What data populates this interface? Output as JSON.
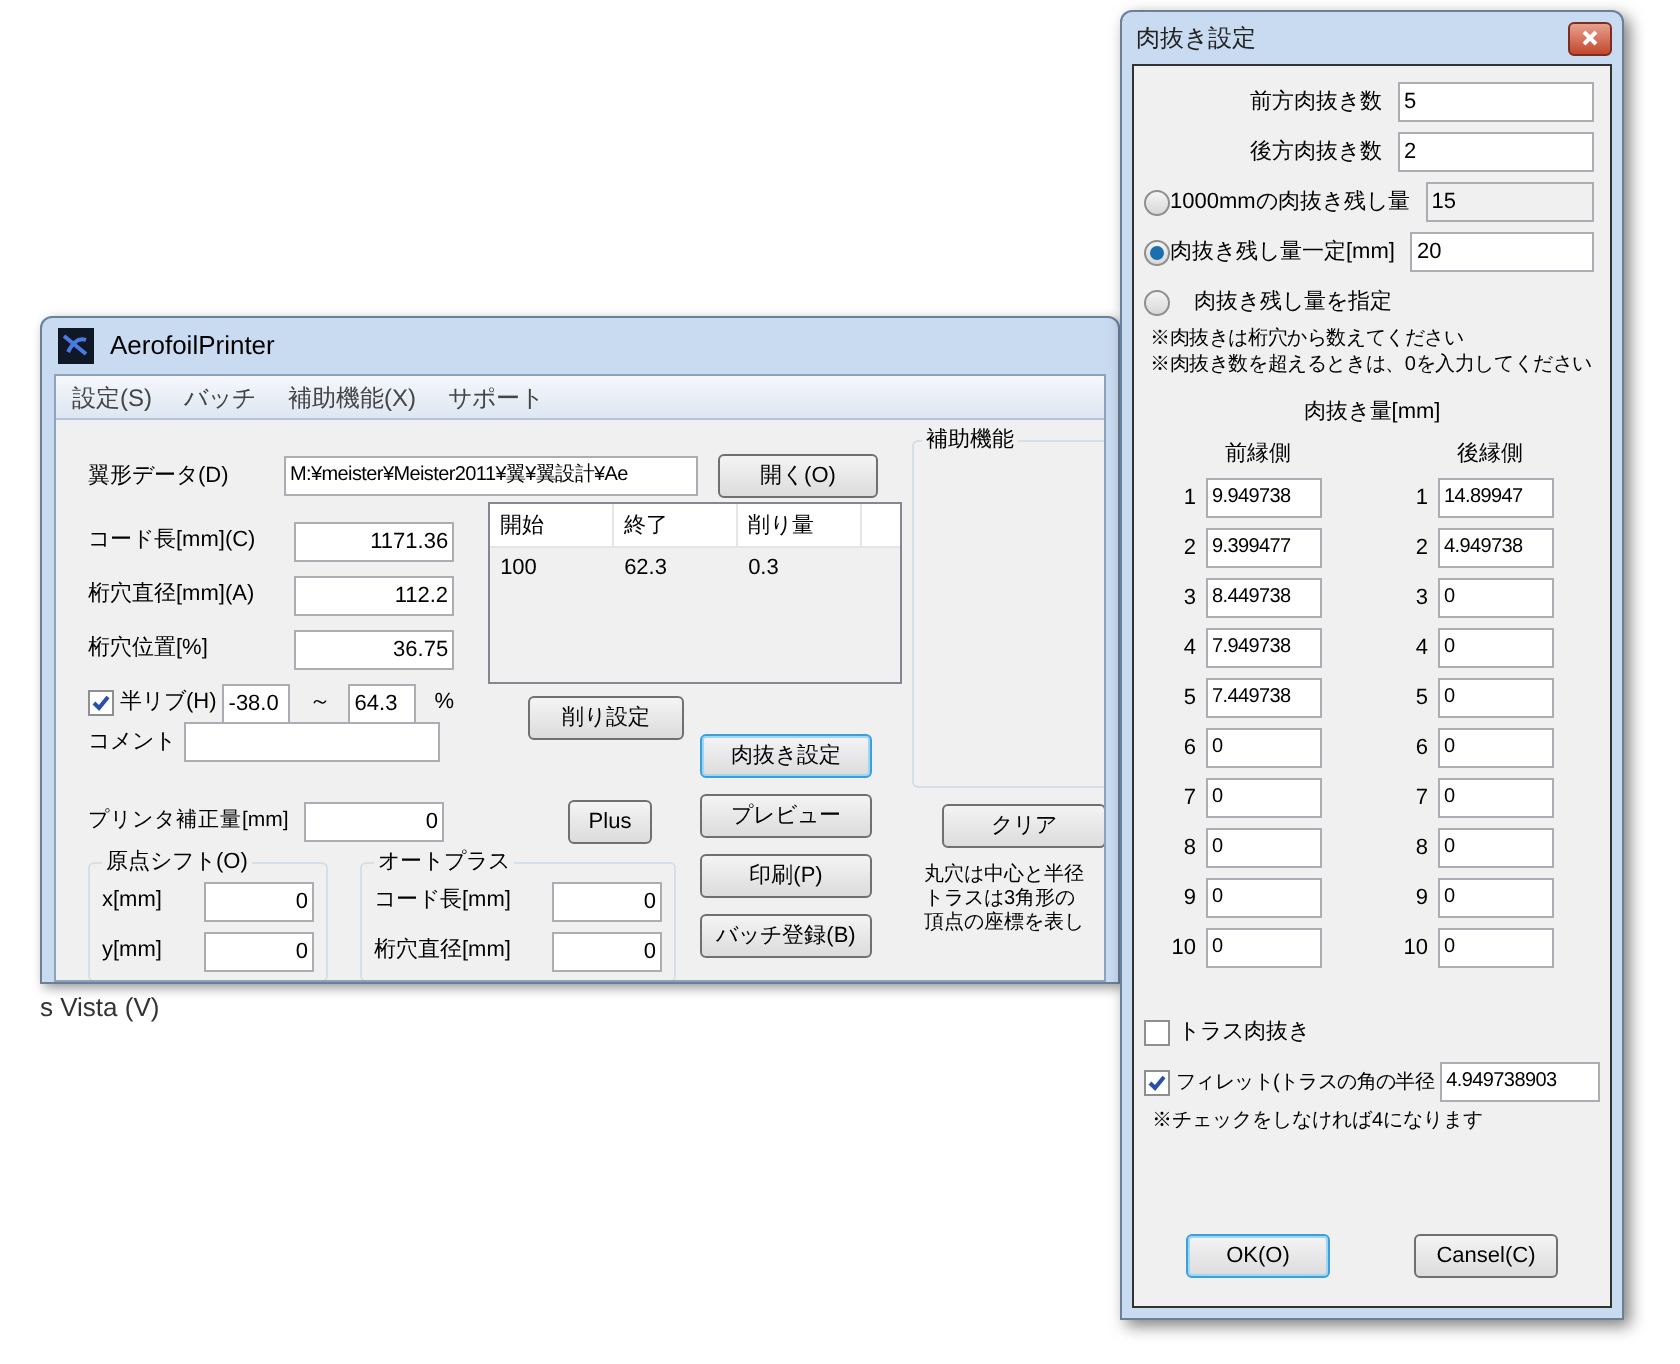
{
  "background_text": "s Vista (V)",
  "main_window": {
    "title": "AerofoilPrinter",
    "menu": [
      "設定(S)",
      "バッチ",
      "補助機能(X)",
      "サポート"
    ],
    "airfoil_data": {
      "label": "翼形データ(D)",
      "value": "M:¥meister¥Meister2011¥翼¥翼設計¥Ae"
    },
    "open_button": "開く(O)",
    "fields": [
      {
        "label": "コード長[mm](C)",
        "value": "1171.36"
      },
      {
        "label": "桁穴直径[mm](A)",
        "value": "112.2"
      },
      {
        "label": "桁穴位置[%]",
        "value": "36.75"
      }
    ],
    "half_rib": {
      "label": "半リブ(H)",
      "checked": true,
      "from": "-38.0",
      "separator": "～",
      "to": "64.3",
      "unit": "%"
    },
    "comment": {
      "label": "コメント"
    },
    "table": {
      "columns": [
        "開始",
        "終了",
        "削り量"
      ],
      "rows": [
        [
          "100",
          "62.3",
          "0.3"
        ]
      ]
    },
    "cut_settings_button": "削り設定",
    "printer_correction": {
      "label": "プリンタ補正量[mm]",
      "value": "0"
    },
    "plus_button": "Plus",
    "origin_shift": {
      "title": "原点シフト(O)",
      "fields": [
        {
          "label": "x[mm]",
          "value": "0"
        },
        {
          "label": "y[mm]",
          "value": "0"
        }
      ]
    },
    "auto_plus": {
      "title": "オートプラス",
      "fields": [
        {
          "label": "コード長[mm]",
          "value": "0"
        },
        {
          "label": "桁穴直径[mm]",
          "value": "0"
        }
      ]
    },
    "action_buttons": [
      {
        "label": "肉抜き設定",
        "focused": true
      },
      {
        "label": "プレビュー",
        "focused": false
      },
      {
        "label": "印刷(P)",
        "focused": false
      },
      {
        "label": "バッチ登録(B)",
        "focused": false
      }
    ],
    "aux_group": {
      "title": "補助機能"
    },
    "clear_button": "クリア",
    "note_lines": [
      "丸穴は中心と半径",
      "トラスは3角形の",
      "頂点の座標を表し"
    ]
  },
  "dialog": {
    "title": "肉抜き設定",
    "front_count": {
      "label": "前方肉抜き数",
      "value": "5"
    },
    "rear_count": {
      "label": "後方肉抜き数",
      "value": "2"
    },
    "options": [
      {
        "label": "1000mmの肉抜き残し量",
        "selected": false,
        "value": "15",
        "disabled": true
      },
      {
        "label": "肉抜き残し量一定[mm]",
        "selected": true,
        "value": "20",
        "disabled": false
      },
      {
        "label": "肉抜き残し量を指定",
        "selected": false
      }
    ],
    "notes": [
      "※肉抜きは桁穴から数えてください",
      "※肉抜き数を超えるときは、0を入力してください"
    ],
    "amount_title": "肉抜き量[mm]",
    "columns": [
      {
        "title": "前縁側",
        "rows": [
          {
            "index": "1",
            "value": "9.949738"
          },
          {
            "index": "2",
            "value": "9.399477"
          },
          {
            "index": "3",
            "value": "8.449738"
          },
          {
            "index": "4",
            "value": "7.949738"
          },
          {
            "index": "5",
            "value": "7.449738"
          },
          {
            "index": "6",
            "value": "0"
          },
          {
            "index": "7",
            "value": "0"
          },
          {
            "index": "8",
            "value": "0"
          },
          {
            "index": "9",
            "value": "0"
          },
          {
            "index": "10",
            "value": "0"
          }
        ]
      },
      {
        "title": "後縁側",
        "rows": [
          {
            "index": "1",
            "value": "14.89947"
          },
          {
            "index": "2",
            "value": "4.949738"
          },
          {
            "index": "3",
            "value": "0"
          },
          {
            "index": "4",
            "value": "0"
          },
          {
            "index": "5",
            "value": "0"
          },
          {
            "index": "6",
            "value": "0"
          },
          {
            "index": "7",
            "value": "0"
          },
          {
            "index": "8",
            "value": "0"
          },
          {
            "index": "9",
            "value": "0"
          },
          {
            "index": "10",
            "value": "0"
          }
        ]
      }
    ],
    "truss": {
      "label": "トラス肉抜き",
      "checked": false
    },
    "fillet": {
      "label": "フィレット(トラスの角の半径",
      "checked": true,
      "value": "4.949738903"
    },
    "fillet_note": "※チェックをしなければ4になります",
    "buttons": [
      {
        "label": "OK(O)",
        "default": true
      },
      {
        "label": "Cansel(C)",
        "default": false
      }
    ]
  }
}
